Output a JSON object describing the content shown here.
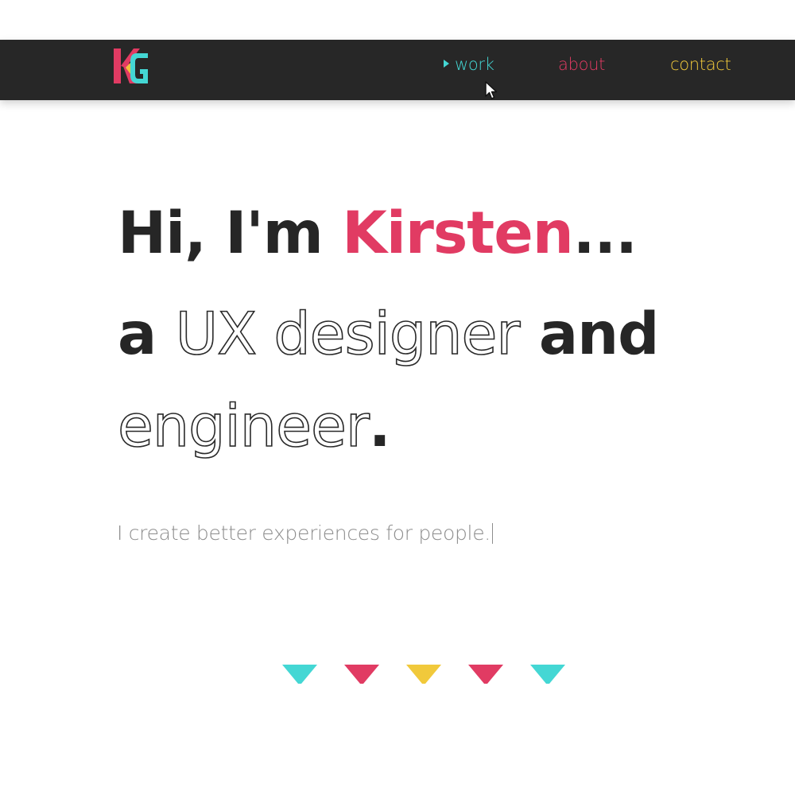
{
  "nav": {
    "logo_text": "KG",
    "links": [
      {
        "label": "work",
        "color": "#44d7d4",
        "active": true
      },
      {
        "label": "about",
        "color": "#e13b63",
        "active": false
      },
      {
        "label": "contact",
        "color": "#f1c93b",
        "active": false
      }
    ],
    "background": "#272727"
  },
  "hero": {
    "line1": {
      "greeting": "Hi, I'm ",
      "name": "Kirsten",
      "ellipsis": "..."
    },
    "line2": {
      "prefix": "a ",
      "role": "UX designer",
      "conjunction": " and"
    },
    "line3": {
      "role": "engineer",
      "period": "."
    },
    "tagline": "I create better experiences for people."
  },
  "colors": {
    "accent_pink": "#e13b63",
    "accent_teal": "#44d7d4",
    "accent_yellow": "#f1c93b",
    "text_dark": "#262626",
    "text_muted": "#8d8d8d"
  },
  "scroll_indicators": [
    {
      "icon": "down-triangle-icon",
      "color": "#44d7d4"
    },
    {
      "icon": "down-triangle-icon",
      "color": "#e13b63"
    },
    {
      "icon": "down-triangle-icon",
      "color": "#f1c93b"
    },
    {
      "icon": "down-triangle-icon",
      "color": "#e13b63"
    },
    {
      "icon": "down-triangle-icon",
      "color": "#44d7d4"
    }
  ]
}
